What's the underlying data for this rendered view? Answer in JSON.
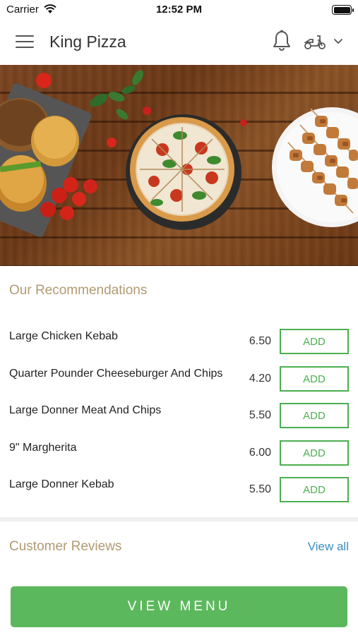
{
  "status_bar": {
    "carrier": "Carrier",
    "time": "12:52 PM",
    "icons": [
      "wifi-icon",
      "battery-icon"
    ]
  },
  "nav": {
    "title": "King Pizza",
    "icons": [
      "hamburger-menu-icon",
      "bell-icon",
      "scooter-icon",
      "chevron-down-icon"
    ]
  },
  "hero": {
    "image": "food-banner",
    "colors": {
      "wood": "#7a4420"
    }
  },
  "recommendations": {
    "title": "Our Recommendations",
    "items": [
      {
        "name": "Large Chicken Kebab",
        "price": "6.50",
        "button": "ADD"
      },
      {
        "name": "Quarter Pounder Cheeseburger And Chips",
        "price": "4.20",
        "button": "ADD"
      },
      {
        "name": "Large Donner Meat And Chips",
        "price": "5.50",
        "button": "ADD"
      },
      {
        "name": "9\" Margherita",
        "price": "6.00",
        "button": "ADD"
      },
      {
        "name": "Large Donner Kebab",
        "price": "5.50",
        "button": "ADD"
      }
    ]
  },
  "reviews": {
    "title": "Customer Reviews",
    "view_all": "View all"
  },
  "footer": {
    "view_menu": "VIEW MENU"
  },
  "colors": {
    "accent_green": "#5cb85c",
    "section_title": "#b09a72",
    "link_blue": "#3a8fc0"
  }
}
